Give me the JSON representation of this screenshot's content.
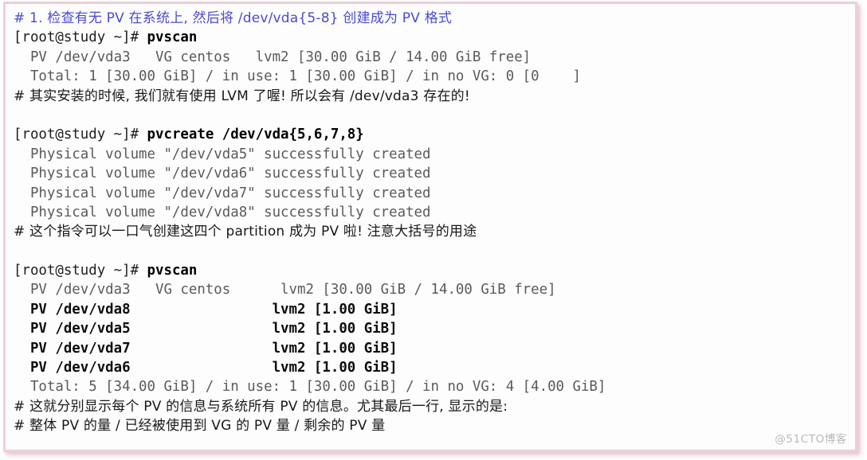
{
  "panel": {
    "border_color": "#edcfd6",
    "background_color": "#fdfdfd",
    "shadow_color": "#e2c0c8"
  },
  "colors": {
    "comment_blue": "#4a4ad0",
    "comment_dark": "#181818",
    "command_bold": "#000000",
    "output_gray": "#5a5a5a",
    "output_bold": "#0c0c0c",
    "watermark": "#b9b9b9"
  },
  "watermark": {
    "text": "@51CTO博客"
  },
  "terminal": {
    "lines": [
      {
        "id": "comment-step-1",
        "role": "comment-blue",
        "text": "# 1. 检查有无 PV 在系统上, 然后将 /dev/vda{5-8} 创建成为 PV 格式"
      },
      {
        "id": "prompt-pvscan-1",
        "role": "prompt-command",
        "prompt": "[root@study ~]# ",
        "command": "pvscan"
      },
      {
        "id": "out-pvscan1-vda3",
        "role": "output",
        "text": "  PV /dev/vda3   VG centos   lvm2 [30.00 GiB / 14.00 GiB free]"
      },
      {
        "id": "out-pvscan1-total",
        "role": "output",
        "text": "  Total: 1 [30.00 GiB] / in use: 1 [30.00 GiB] / in no VG: 0 [0    ]"
      },
      {
        "id": "comment-install-lvm",
        "role": "comment-dark",
        "text": "# 其实安装的时候, 我们就有使用 LVM 了喔! 所以会有 /dev/vda3 存在的!"
      },
      {
        "id": "blank-1",
        "role": "blank",
        "text": ""
      },
      {
        "id": "prompt-pvcreate",
        "role": "prompt-command",
        "prompt": "[root@study ~]# ",
        "command": "pvcreate /dev/vda{5,6,7,8}"
      },
      {
        "id": "out-pvcreate-vda5",
        "role": "output",
        "text": "  Physical volume \"/dev/vda5\" successfully created"
      },
      {
        "id": "out-pvcreate-vda6",
        "role": "output",
        "text": "  Physical volume \"/dev/vda6\" successfully created"
      },
      {
        "id": "out-pvcreate-vda7",
        "role": "output",
        "text": "  Physical volume \"/dev/vda7\" successfully created"
      },
      {
        "id": "out-pvcreate-vda8",
        "role": "output",
        "text": "  Physical volume \"/dev/vda8\" successfully created"
      },
      {
        "id": "comment-four-partitions",
        "role": "comment-dark",
        "text": "# 这个指令可以一口气创建这四个 partition 成为 PV 啦! 注意大括号的用途"
      },
      {
        "id": "blank-2",
        "role": "blank",
        "text": ""
      },
      {
        "id": "prompt-pvscan-2",
        "role": "prompt-command",
        "prompt": "[root@study ~]# ",
        "command": "pvscan"
      },
      {
        "id": "out-pvscan2-vda3",
        "role": "output",
        "text": "  PV /dev/vda3   VG centos      lvm2 [30.00 GiB / 14.00 GiB free]"
      },
      {
        "id": "out-pvscan2-vda8",
        "role": "output-bold",
        "text": "  PV /dev/vda8                 lvm2 [1.00 GiB]"
      },
      {
        "id": "out-pvscan2-vda5",
        "role": "output-bold",
        "text": "  PV /dev/vda5                 lvm2 [1.00 GiB]"
      },
      {
        "id": "out-pvscan2-vda7",
        "role": "output-bold",
        "text": "  PV /dev/vda7                 lvm2 [1.00 GiB]"
      },
      {
        "id": "out-pvscan2-vda6",
        "role": "output-bold",
        "text": "  PV /dev/vda6                 lvm2 [1.00 GiB]"
      },
      {
        "id": "out-pvscan2-total",
        "role": "output",
        "text": "  Total: 5 [34.00 GiB] / in use: 1 [30.00 GiB] / in no VG: 4 [4.00 GiB]"
      },
      {
        "id": "comment-explain-1",
        "role": "comment-dark",
        "text": "# 这就分别显示每个 PV 的信息与系统所有 PV 的信息。尤其最后一行, 显示的是:"
      },
      {
        "id": "comment-explain-2",
        "role": "comment-dark",
        "text": "# 整体 PV 的量 / 已经被使用到 VG 的 PV 量 / 剩余的 PV 量"
      }
    ]
  }
}
